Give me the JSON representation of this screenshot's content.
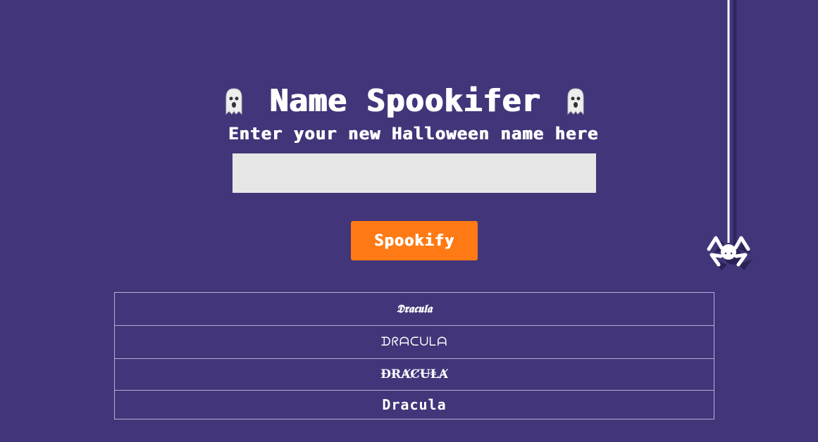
{
  "title": "Name Spookifer",
  "subtitle": "Enter your new Halloween name here",
  "name_input": {
    "value": "",
    "placeholder": ""
  },
  "spookify_button_label": "Spookify",
  "results": [
    "𝕯𝖗𝖆𝖈𝖚𝖑𝖆",
    "ᗪᖇᗩᑕᑌᒪᗩ",
    "ĐɌȺȻɄⱠȺ",
    "Dracula"
  ],
  "icons": {
    "left": "ghost-icon",
    "right": "ghost-icon",
    "decoration": "spider-icon"
  },
  "colors": {
    "background": "#423579",
    "button": "#ff7a14",
    "input": "#e6e6e6"
  }
}
